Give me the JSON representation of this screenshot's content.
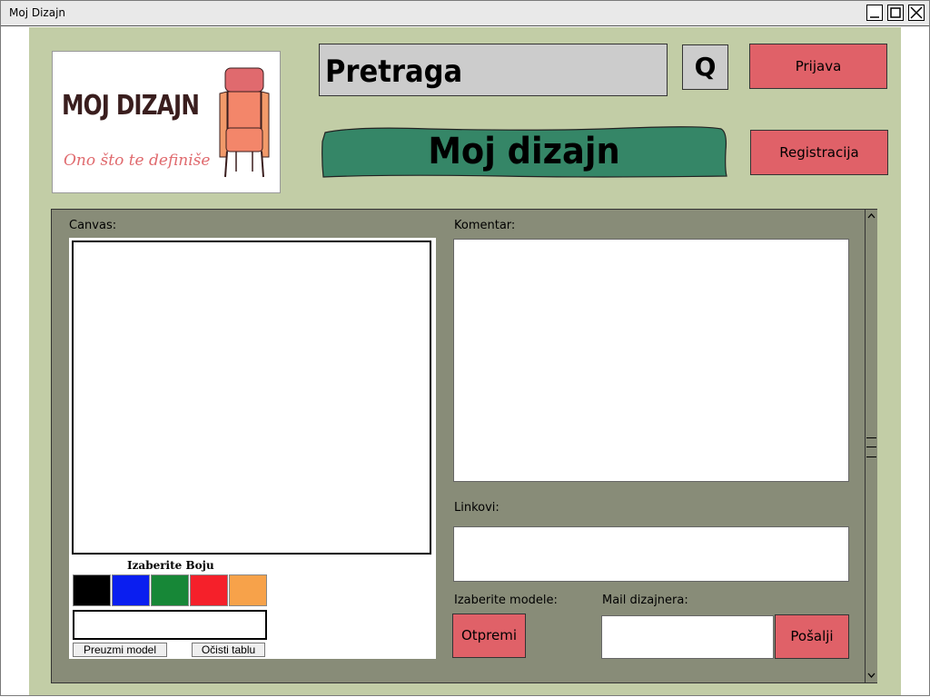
{
  "window": {
    "title": "Moj Dizajn"
  },
  "logo": {
    "title": "MOJ DIZAJN",
    "tagline": "Ono što te definiše"
  },
  "search": {
    "placeholder": "Pretraga",
    "button": "Q"
  },
  "header": {
    "banner": "Moj dizajn",
    "login": "Prijava",
    "register": "Registracija"
  },
  "canvas": {
    "label": "Canvas:",
    "color_title": "Izaberite Boju",
    "colors": [
      "#000000",
      "#0a1ef0",
      "#178737",
      "#f5202a",
      "#f7a24a"
    ],
    "download": "Preuzmi model",
    "clear": "Očisti tablu"
  },
  "comment": {
    "label": "Komentar:"
  },
  "links": {
    "label": "Linkovi:"
  },
  "models": {
    "label": "Izaberite modele:",
    "upload": "Otpremi"
  },
  "mail": {
    "label": "Mail dizajnera:",
    "send": "Pošalji"
  },
  "theme": {
    "background": "#c2cda6",
    "panel": "#888c78",
    "accent_red": "#e06168",
    "banner_green": "#358667"
  }
}
